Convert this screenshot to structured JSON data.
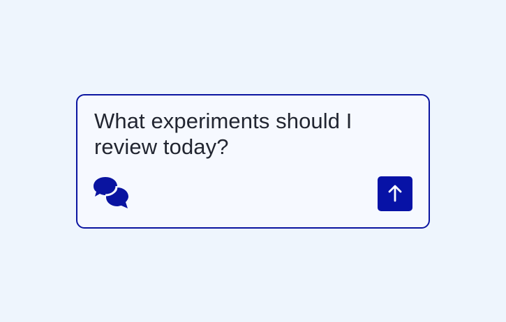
{
  "theme": {
    "page_background": "#eef5fd",
    "card_background": "#f6f9ff",
    "accent": "#0a14a0",
    "text_color": "#222631"
  },
  "chat_input": {
    "text": "What experiments should I review today?",
    "icon": "chat-bubbles-icon"
  },
  "send_button": {
    "icon": "arrow-up-icon",
    "color": "#0712a6"
  }
}
